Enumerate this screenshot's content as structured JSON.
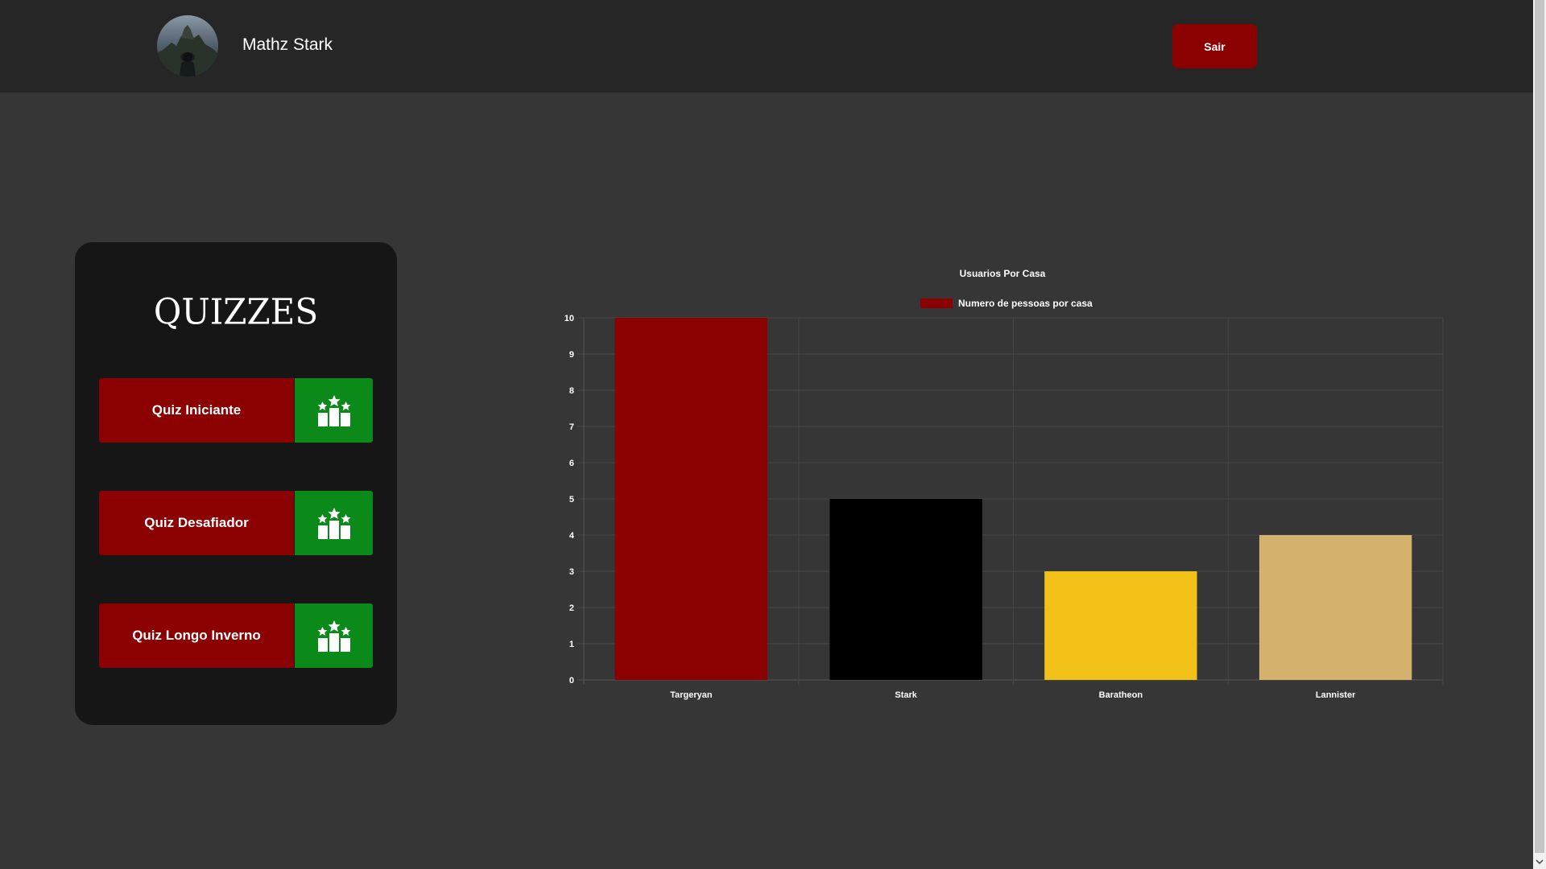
{
  "header": {
    "username": "Mathz Stark",
    "logout_label": "Sair"
  },
  "quiz_panel": {
    "title": "QUIZZES",
    "items": [
      {
        "label": "Quiz Iniciante"
      },
      {
        "label": "Quiz Desafiador"
      },
      {
        "label": "Quiz Longo Inverno"
      }
    ]
  },
  "icons": {
    "ranking": "podium-icon",
    "scroll_down": "chevron-down-icon"
  },
  "colors": {
    "primary_red": "#8b0000",
    "ranking_green": "#0b8a1a",
    "header_bg": "#262626",
    "page_bg": "#363636"
  },
  "chart_data": {
    "type": "bar",
    "title": "Usuarios Por Casa",
    "categories": [
      "Targeryan",
      "Stark",
      "Baratheon",
      "Lannister"
    ],
    "series": [
      {
        "name": "Numero de pessoas por casa",
        "values": [
          10,
          5,
          3,
          4
        ],
        "colors": [
          "#8b0000",
          "#000000",
          "#f2c118",
          "#d4b26d"
        ]
      }
    ],
    "yticks": [
      "0",
      "1",
      "2",
      "3",
      "4",
      "5",
      "6",
      "7",
      "8",
      "9",
      "10"
    ],
    "ylim": [
      0,
      10
    ],
    "legend_position": "top",
    "grid": true
  }
}
